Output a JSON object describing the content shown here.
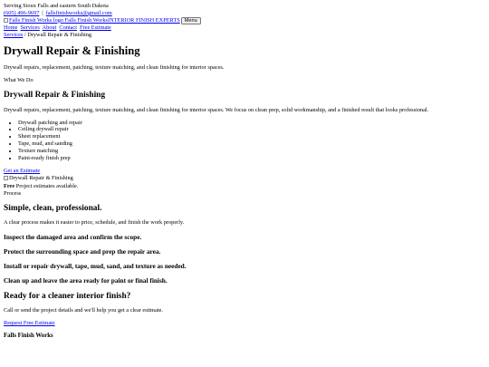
{
  "topbar": {
    "service_area": "Serving Sioux Falls and eastern South Dakota",
    "phone": "(605) 496-9697",
    "separator": "|",
    "email": "fallsfinishworks@gmail.com"
  },
  "brand": {
    "logo_alt": "Falls Finish Works logo",
    "name": "Falls Finish Works",
    "tagline": "INTERIOR FINISH EXPERTS",
    "menu_label": "Menu"
  },
  "nav": {
    "items": [
      "Home",
      "Services",
      "About",
      "Contact",
      "Free Estimate"
    ]
  },
  "breadcrumb": {
    "parent": "Services",
    "separator": "/",
    "current": "Drywall Repair & Finishing"
  },
  "hero": {
    "title": "Drywall Repair & Finishing",
    "lede": "Drywall repairs, replacement, patching, texture matching, and clean finishing for interior spaces.",
    "eyebrow": "What We Do"
  },
  "what_we_do": {
    "title": "Drywall Repair & Finishing",
    "body": "Drywall repairs, replacement, patching, texture matching, and clean finishing for interior spaces. We focus on clean prep, solid workmanship, and a finished result that looks professional.",
    "list": [
      "Drywall patching and repair",
      "Ceiling drywall repair",
      "Sheet replacement",
      "Tape, mud, and sanding",
      "Texture matching",
      "Paint-ready finish prep"
    ],
    "cta": "Get an Estimate",
    "image_alt": "Drywall Repair & Finishing",
    "estimate_strong": "Free",
    "estimate_text": " Project estimates available.",
    "process_label": "Process"
  },
  "process": {
    "title": "Simple, clean, professional.",
    "intro": "A clear process makes it easier to price, schedule, and finish the work properly.",
    "steps": [
      "Inspect the damaged area and confirm the scope.",
      "Protect the surrounding space and prep the repair area.",
      "Install or repair drywall, tape, mud, sand, and texture as needed.",
      "Clean up and leave the area ready for paint or final finish."
    ]
  },
  "cta_section": {
    "title": "Ready for a cleaner interior finish?",
    "body": "Call or send the project details and we'll help you get a clear estimate.",
    "link": "Request Free Estimate"
  },
  "footer": {
    "title": "Falls Finish Works"
  }
}
